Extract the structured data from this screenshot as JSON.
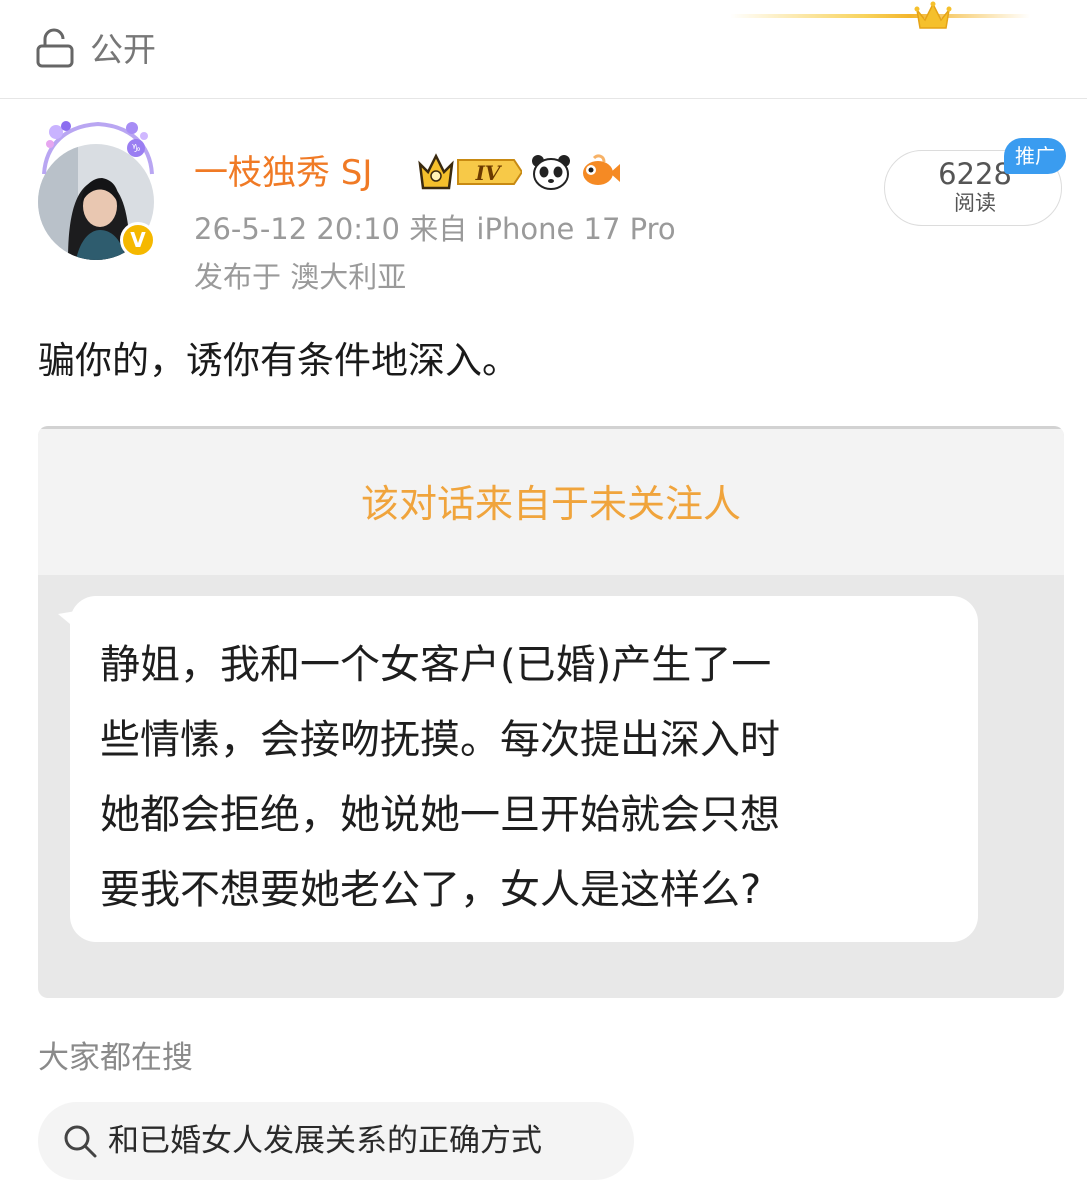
{
  "header": {
    "visibility_label": "公开",
    "visibility_icon": "lock-icon",
    "decoration_icon": "crown-icon"
  },
  "post": {
    "author": {
      "name": "一枝独秀 SJ",
      "verified_badge": "V",
      "level_badge": "IV",
      "badge_icons": [
        "crown-level-icon",
        "panda-icon",
        "fish-icon"
      ]
    },
    "timestamp": "26-5-12 20:10  来自 iPhone 17 Pro",
    "location": "发布于 澳大利亚",
    "read_count": "6228",
    "read_label": "阅读",
    "promo_tag": "推广",
    "text": "骗你的，诱你有条件地深入。"
  },
  "embedded_image": {
    "notice": "该对话来自于未关注人",
    "message_lines": [
      "静姐，我和一个女客户(已婚)产生了一",
      "些情愫，会接吻抚摸。每次提出深入时",
      "她都会拒绝，她说她一旦开始就会只想",
      "要我不想要她老公了，女人是这样么?"
    ]
  },
  "search": {
    "heading": "大家都在搜",
    "query": "和已婚女人发展关系的正确方式"
  },
  "colors": {
    "username": "#f07a25",
    "secondary_text": "#9a9a9a",
    "promo_tag": "#3a9cf0",
    "notice_text": "#f0a43c",
    "verified_badge": "#f5b800"
  }
}
